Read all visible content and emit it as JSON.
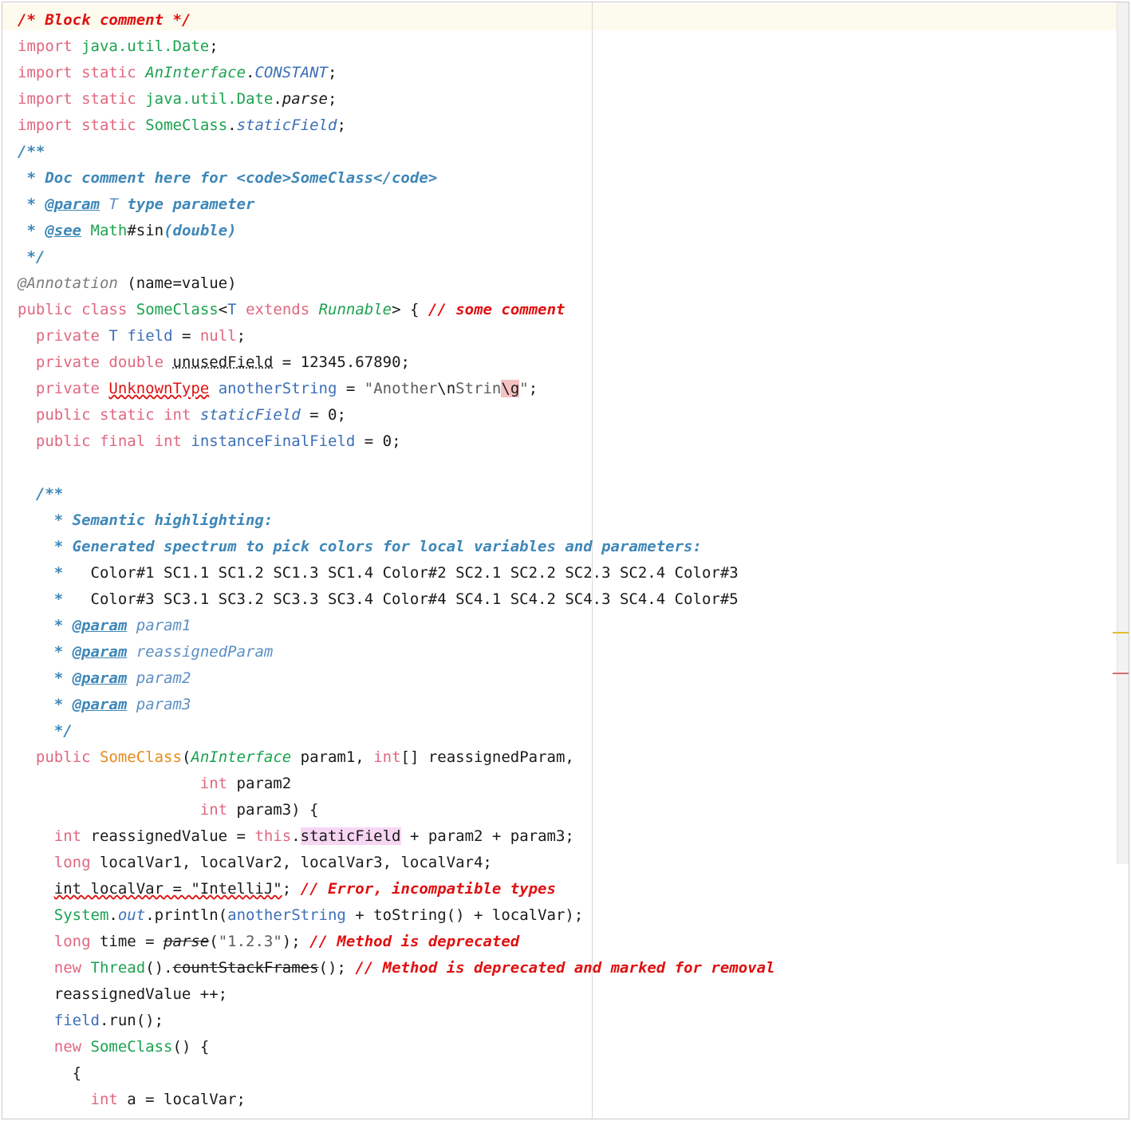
{
  "editor": {
    "lines": [
      [
        [
          "/* Block comment */",
          "cmt"
        ]
      ],
      [
        [
          "import",
          "kw"
        ],
        [
          " ",
          ""
        ],
        [
          "java.util.Date",
          "cls"
        ],
        [
          ";",
          ""
        ]
      ],
      [
        [
          "import",
          "kw"
        ],
        [
          " ",
          ""
        ],
        [
          "static",
          "kw"
        ],
        [
          " ",
          ""
        ],
        [
          "AnInterface",
          "cls-i"
        ],
        [
          ".",
          ""
        ],
        [
          "CONSTANT",
          "const-i"
        ],
        [
          ";",
          ""
        ]
      ],
      [
        [
          "import",
          "kw"
        ],
        [
          " ",
          ""
        ],
        [
          "static",
          "kw"
        ],
        [
          " ",
          ""
        ],
        [
          "java.util.Date",
          "cls"
        ],
        [
          ".",
          ""
        ],
        [
          "parse",
          "meth-i"
        ],
        [
          ";",
          ""
        ]
      ],
      [
        [
          "import",
          "kw"
        ],
        [
          " ",
          ""
        ],
        [
          "static",
          "kw"
        ],
        [
          " ",
          ""
        ],
        [
          "SomeClass",
          "cls"
        ],
        [
          ".",
          ""
        ],
        [
          "staticField",
          "field-i"
        ],
        [
          ";",
          ""
        ]
      ],
      [
        [
          "/**",
          "doc"
        ]
      ],
      [
        [
          " * Doc comment here for <code>SomeClass</code>",
          "doc"
        ]
      ],
      [
        [
          " * ",
          "doc"
        ],
        [
          "@param",
          "doc-tag"
        ],
        [
          " ",
          ""
        ],
        [
          "T",
          "doc-plain"
        ],
        [
          " type parameter",
          "doc"
        ]
      ],
      [
        [
          " * ",
          "doc"
        ],
        [
          "@see",
          "doc-tag"
        ],
        [
          " ",
          ""
        ],
        [
          "Math",
          "cls"
        ],
        [
          "#",
          ""
        ],
        [
          "sin",
          ""
        ],
        [
          "(double)",
          "doc"
        ]
      ],
      [
        [
          " */",
          "doc"
        ]
      ],
      [
        [
          "@Annotation",
          "ann"
        ],
        [
          " (name=value)",
          ""
        ]
      ],
      [
        [
          "public",
          "kw"
        ],
        [
          " ",
          ""
        ],
        [
          "class",
          "kw"
        ],
        [
          " ",
          ""
        ],
        [
          "SomeClass",
          "cls"
        ],
        [
          "<",
          ""
        ],
        [
          "T",
          "field"
        ],
        [
          " ",
          ""
        ],
        [
          "extends",
          "kw"
        ],
        [
          " ",
          ""
        ],
        [
          "Runnable",
          "cls-i"
        ],
        [
          "> { ",
          ""
        ],
        [
          "// some comment",
          "cmt"
        ]
      ],
      [
        [
          "  ",
          ""
        ],
        [
          "private",
          "kw"
        ],
        [
          " ",
          ""
        ],
        [
          "T",
          "field"
        ],
        [
          " ",
          ""
        ],
        [
          "field",
          "field"
        ],
        [
          " = ",
          ""
        ],
        [
          "null",
          "kw"
        ],
        [
          ";",
          ""
        ]
      ],
      [
        [
          "  ",
          ""
        ],
        [
          "private",
          "kw"
        ],
        [
          " ",
          ""
        ],
        [
          "double",
          "kw"
        ],
        [
          " ",
          ""
        ],
        [
          "unusedField",
          "unused"
        ],
        [
          " = 12345.67890;",
          ""
        ]
      ],
      [
        [
          "  ",
          ""
        ],
        [
          "private",
          "kw"
        ],
        [
          " ",
          ""
        ],
        [
          "UnknownType",
          "err"
        ],
        [
          " ",
          ""
        ],
        [
          "anotherString",
          "field"
        ],
        [
          " = ",
          ""
        ],
        [
          "\"Another",
          "str"
        ],
        [
          "\\n",
          "esc"
        ],
        [
          "Strin",
          "str"
        ],
        [
          "\\g",
          "esc-err"
        ],
        [
          "\"",
          "str"
        ],
        [
          ";",
          ""
        ]
      ],
      [
        [
          "  ",
          ""
        ],
        [
          "public",
          "kw"
        ],
        [
          " ",
          ""
        ],
        [
          "static",
          "kw"
        ],
        [
          " ",
          ""
        ],
        [
          "int",
          "kw"
        ],
        [
          " ",
          ""
        ],
        [
          "staticField",
          "field-i"
        ],
        [
          " = 0;",
          ""
        ]
      ],
      [
        [
          "  ",
          ""
        ],
        [
          "public",
          "kw"
        ],
        [
          " ",
          ""
        ],
        [
          "final",
          "kw"
        ],
        [
          " ",
          ""
        ],
        [
          "int",
          "kw"
        ],
        [
          " ",
          ""
        ],
        [
          "instanceFinalField",
          "field"
        ],
        [
          " = 0;",
          ""
        ]
      ],
      [],
      [
        [
          "  ",
          ""
        ],
        [
          "/**",
          "doc"
        ]
      ],
      [
        [
          "    ",
          ""
        ],
        [
          "* Semantic highlighting:",
          "doc"
        ]
      ],
      [
        [
          "    ",
          ""
        ],
        [
          "* Generated spectrum to pick colors for local variables and parameters:",
          "doc"
        ]
      ],
      [
        [
          "    ",
          ""
        ],
        [
          "* ",
          "doc"
        ],
        [
          "  Color#1 SC1.1 SC1.2 SC1.3 SC1.4 Color#2 SC2.1 SC2.2 SC2.3 SC2.4 Color#3",
          ""
        ]
      ],
      [
        [
          "    ",
          ""
        ],
        [
          "* ",
          "doc"
        ],
        [
          "  Color#3 SC3.1 SC3.2 SC3.3 SC3.4 Color#4 SC4.1 SC4.2 SC4.3 SC4.4 Color#5",
          ""
        ]
      ],
      [
        [
          "    ",
          ""
        ],
        [
          "* ",
          "doc"
        ],
        [
          "@param",
          "doc-tag"
        ],
        [
          " ",
          ""
        ],
        [
          "param1",
          "doc-plain"
        ]
      ],
      [
        [
          "    ",
          ""
        ],
        [
          "* ",
          "doc"
        ],
        [
          "@param",
          "doc-tag"
        ],
        [
          " ",
          ""
        ],
        [
          "reassignedParam",
          "doc-plain"
        ]
      ],
      [
        [
          "    ",
          ""
        ],
        [
          "* ",
          "doc"
        ],
        [
          "@param",
          "doc-tag"
        ],
        [
          " ",
          ""
        ],
        [
          "param2",
          "doc-plain"
        ]
      ],
      [
        [
          "    ",
          ""
        ],
        [
          "* ",
          "doc"
        ],
        [
          "@param",
          "doc-tag"
        ],
        [
          " ",
          ""
        ],
        [
          "param3",
          "doc-plain"
        ]
      ],
      [
        [
          "    ",
          ""
        ],
        [
          "*/",
          "doc"
        ]
      ],
      [
        [
          "  ",
          ""
        ],
        [
          "public",
          "kw"
        ],
        [
          " ",
          ""
        ],
        [
          "SomeClass",
          "ctor"
        ],
        [
          "(",
          ""
        ],
        [
          "AnInterface",
          "cls-i"
        ],
        [
          " param1, ",
          ""
        ],
        [
          "int",
          "kw"
        ],
        [
          "[] reassignedParam,",
          ""
        ]
      ],
      [
        [
          "                    ",
          ""
        ],
        [
          "int",
          "kw"
        ],
        [
          " param2",
          ""
        ]
      ],
      [
        [
          "                    ",
          ""
        ],
        [
          "int",
          "kw"
        ],
        [
          " param3) {",
          ""
        ]
      ],
      [
        [
          "    ",
          ""
        ],
        [
          "int",
          "kw"
        ],
        [
          " reassignedValue = ",
          ""
        ],
        [
          "this",
          "kw"
        ],
        [
          ".",
          ""
        ],
        [
          "staticField",
          "hl"
        ],
        [
          " + param2 + param3;",
          ""
        ]
      ],
      [
        [
          "    ",
          ""
        ],
        [
          "long",
          "kw"
        ],
        [
          " localVar1, localVar2, localVar3, localVar4;",
          ""
        ]
      ],
      [
        [
          "    ",
          ""
        ],
        [
          "int localVar = \"IntelliJ\"",
          "err-ul"
        ],
        [
          "; ",
          ""
        ],
        [
          "// Error, incompatible types",
          "cmt"
        ]
      ],
      [
        [
          "    ",
          ""
        ],
        [
          "System",
          "cls"
        ],
        [
          ".",
          ""
        ],
        [
          "out",
          "field-i"
        ],
        [
          ".println(",
          ""
        ],
        [
          "anotherString",
          "field"
        ],
        [
          " + toString() + localVar);",
          ""
        ]
      ],
      [
        [
          "    ",
          ""
        ],
        [
          "long",
          "kw"
        ],
        [
          " time = ",
          ""
        ],
        [
          "parse",
          "deprec-i"
        ],
        [
          "(",
          ""
        ],
        [
          "\"1.2.3\"",
          "str"
        ],
        [
          "); ",
          ""
        ],
        [
          "// Method is deprecated",
          "cmt"
        ]
      ],
      [
        [
          "    ",
          ""
        ],
        [
          "new",
          "kw"
        ],
        [
          " ",
          ""
        ],
        [
          "Thread",
          "cls"
        ],
        [
          "().",
          ""
        ],
        [
          "countStackFrames",
          "deprec"
        ],
        [
          "(); ",
          ""
        ],
        [
          "// Method is deprecated and marked for removal",
          "cmt"
        ]
      ],
      [
        [
          "    reassignedValue ++;",
          ""
        ]
      ],
      [
        [
          "    ",
          ""
        ],
        [
          "field",
          "field"
        ],
        [
          ".run();",
          ""
        ]
      ],
      [
        [
          "    ",
          ""
        ],
        [
          "new",
          "kw"
        ],
        [
          " ",
          ""
        ],
        [
          "SomeClass",
          "cls"
        ],
        [
          "() {",
          ""
        ]
      ],
      [
        [
          "      {",
          ""
        ]
      ],
      [
        [
          "        ",
          ""
        ],
        [
          "int",
          "kw"
        ],
        [
          " a = localVar;",
          ""
        ]
      ],
      [
        [
          "      }",
          ""
        ]
      ]
    ]
  },
  "gutter_markers": [
    {
      "color": "#e2c12a"
    },
    {
      "color": "#d07070"
    }
  ]
}
